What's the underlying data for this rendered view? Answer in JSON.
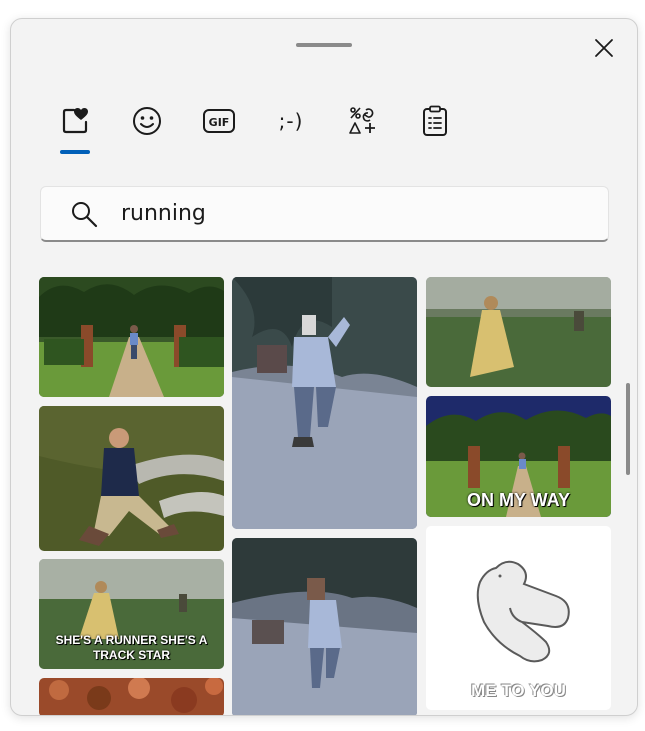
{
  "window": {
    "close_label": "×"
  },
  "tabs": [
    {
      "id": "favorites",
      "icon": "heart-icon",
      "active": true
    },
    {
      "id": "emoji",
      "icon": "smiley-icon",
      "active": false
    },
    {
      "id": "gif",
      "icon": "gif-icon",
      "label": "GIF",
      "active": false
    },
    {
      "id": "kaomoji",
      "icon": "kaomoji-icon",
      "label": ";-)",
      "active": false
    },
    {
      "id": "symbols",
      "icon": "symbols-icon",
      "active": false
    },
    {
      "id": "clipboard",
      "icon": "clipboard-icon",
      "active": false
    }
  ],
  "search": {
    "value": "running"
  },
  "results": [
    {
      "id": "gif-1",
      "caption": ""
    },
    {
      "id": "gif-2",
      "caption": ""
    },
    {
      "id": "gif-3",
      "caption": ""
    },
    {
      "id": "gif-4",
      "caption": ""
    },
    {
      "id": "gif-5",
      "caption": ""
    },
    {
      "id": "gif-6",
      "caption": "ON MY WAY"
    },
    {
      "id": "gif-7",
      "caption": "SHE'S A RUNNER SHE'S A TRACK STAR"
    },
    {
      "id": "gif-8",
      "caption": ""
    },
    {
      "id": "gif-9",
      "caption": "ME TO YOU"
    },
    {
      "id": "gif-10",
      "caption": ""
    }
  ],
  "colors": {
    "accent": "#005fb8",
    "panel": "#f3f3f3"
  }
}
